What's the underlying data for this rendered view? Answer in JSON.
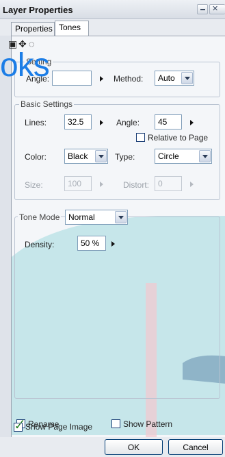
{
  "window": {
    "title": "Layer Properties"
  },
  "tabs": [
    {
      "label": "Properties"
    },
    {
      "label": "Tones"
    }
  ],
  "overlay": {
    "text": "oks"
  },
  "top_group": {
    "label": "Setting",
    "angle_label": "Angle:",
    "method_label": "Method:",
    "method_value": "Auto"
  },
  "basic": {
    "label": "Basic Settings",
    "lines_label": "Lines:",
    "lines_value": "32.5",
    "angle_label": "Angle:",
    "angle_value": "45",
    "relative_label": "Relative to Page",
    "color_label": "Color:",
    "color_value": "Black",
    "type_label": "Type:",
    "type_value": "Circle",
    "size_label": "Size:",
    "size_value": "100",
    "distort_label": "Distort:",
    "distort_value": "0"
  },
  "tone_mode": {
    "label": "Tone Mode",
    "value": "Normal",
    "density_label": "Density:",
    "density_value": "50 %"
  },
  "options": {
    "rename_label": "Rename",
    "rename_checked": true,
    "show_pattern_label": "Show Pattern",
    "show_pattern_checked": false,
    "show_page_image_label": "Show Page Image",
    "show_page_image_checked": true
  },
  "buttons": {
    "ok": "OK",
    "cancel": "Cancel"
  },
  "colors": {
    "accent": "#1c7de6",
    "panel_bg": "#f4f6f9",
    "cyan_bg": "#c6e6ea",
    "titlebar": "#dde2ea"
  }
}
